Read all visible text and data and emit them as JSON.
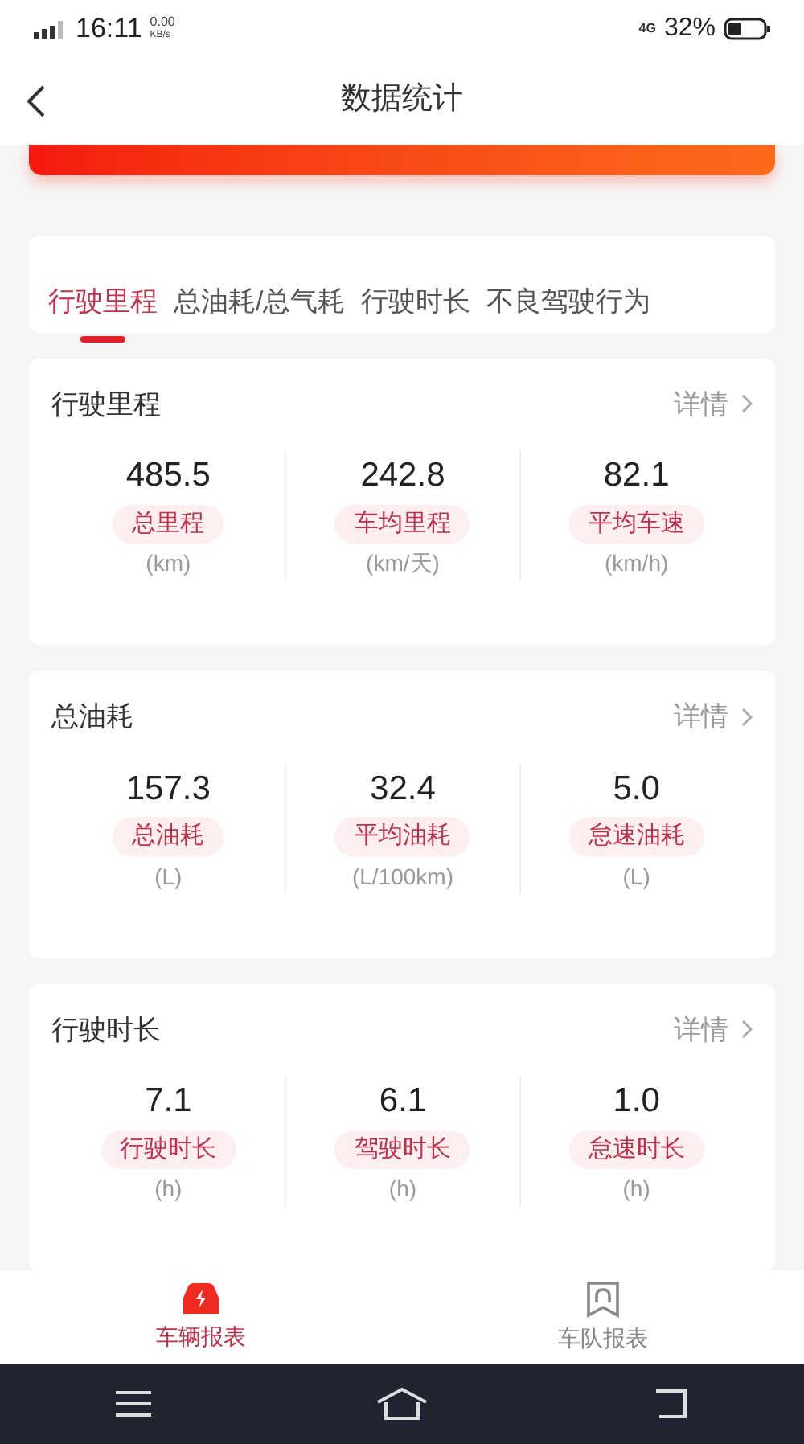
{
  "status_bar": {
    "time": "16:11",
    "speed": "0.00",
    "speed_unit": "KB/s",
    "network": "4G",
    "battery": "32%"
  },
  "header": {
    "title": "数据统计"
  },
  "tabs": [
    {
      "label": "行驶里程",
      "selected": true
    },
    {
      "label": "总油耗/总气耗",
      "selected": false
    },
    {
      "label": "行驶时长",
      "selected": false
    },
    {
      "label": "不良驾驶行为",
      "selected": false
    }
  ],
  "sections": [
    {
      "title": "行驶里程",
      "link": "详情",
      "stats": [
        {
          "value": "485.5",
          "label": "总里程",
          "unit": "(km)"
        },
        {
          "value": "242.8",
          "label": "车均里程",
          "unit": "(km/天)"
        },
        {
          "value": "82.1",
          "label": "平均车速",
          "unit": "(km/h)"
        }
      ]
    },
    {
      "title": "总油耗",
      "link": "详情",
      "stats": [
        {
          "value": "157.3",
          "label": "总油耗",
          "unit": "(L)"
        },
        {
          "value": "32.4",
          "label": "平均油耗",
          "unit": "(L/100km)"
        },
        {
          "value": "5.0",
          "label": "怠速油耗",
          "unit": "(L)"
        }
      ]
    },
    {
      "title": "行驶时长",
      "link": "详情",
      "stats": [
        {
          "value": "7.1",
          "label": "行驶时长",
          "unit": "(h)"
        },
        {
          "value": "6.1",
          "label": "驾驶时长",
          "unit": "(h)"
        },
        {
          "value": "1.0",
          "label": "怠速时长",
          "unit": "(h)"
        }
      ]
    }
  ],
  "bottom_nav": [
    {
      "label": "车辆报表",
      "selected": true
    },
    {
      "label": "车队报表",
      "selected": false
    }
  ]
}
